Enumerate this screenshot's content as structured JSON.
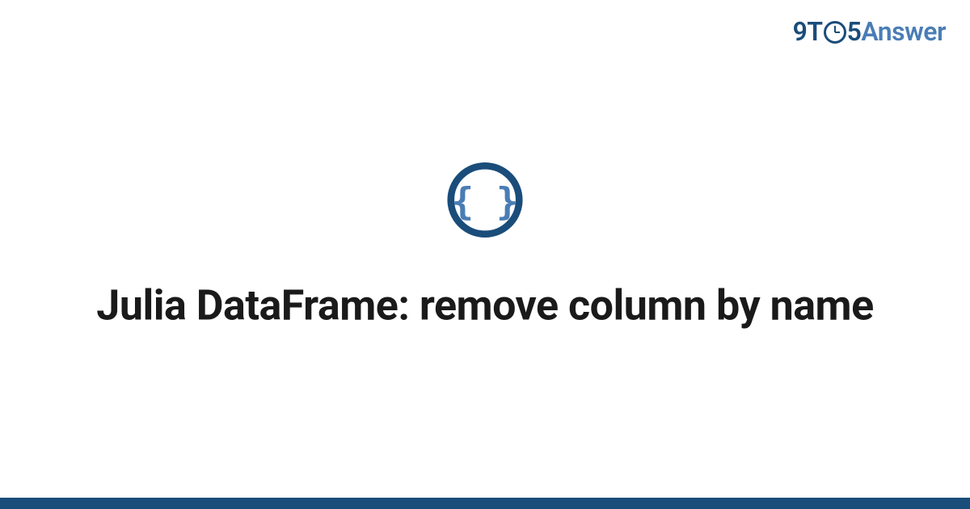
{
  "logo": {
    "part1": "9T",
    "part2": "5",
    "part3": "Answer"
  },
  "icon": {
    "braces": "{ }"
  },
  "title": "Julia DataFrame: remove column by name",
  "colors": {
    "darkBlue": "#1a4d7a",
    "lightBlue": "#4a7db5",
    "text": "#1a1a1a"
  }
}
